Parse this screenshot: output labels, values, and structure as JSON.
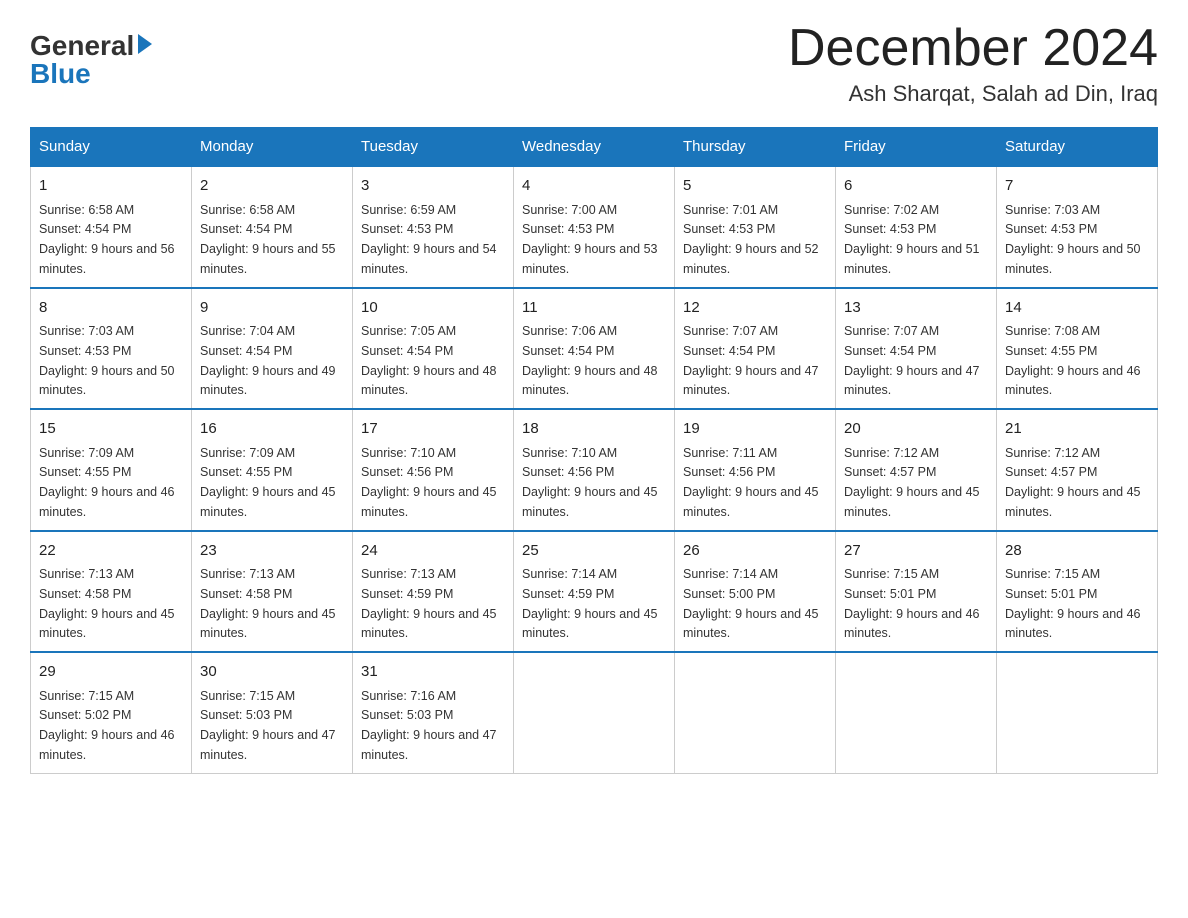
{
  "header": {
    "logo_general": "General",
    "logo_blue": "Blue",
    "month_title": "December 2024",
    "location": "Ash Sharqat, Salah ad Din, Iraq"
  },
  "weekdays": [
    "Sunday",
    "Monday",
    "Tuesday",
    "Wednesday",
    "Thursday",
    "Friday",
    "Saturday"
  ],
  "weeks": [
    [
      {
        "day": "1",
        "sunrise": "6:58 AM",
        "sunset": "4:54 PM",
        "daylight": "9 hours and 56 minutes."
      },
      {
        "day": "2",
        "sunrise": "6:58 AM",
        "sunset": "4:54 PM",
        "daylight": "9 hours and 55 minutes."
      },
      {
        "day": "3",
        "sunrise": "6:59 AM",
        "sunset": "4:53 PM",
        "daylight": "9 hours and 54 minutes."
      },
      {
        "day": "4",
        "sunrise": "7:00 AM",
        "sunset": "4:53 PM",
        "daylight": "9 hours and 53 minutes."
      },
      {
        "day": "5",
        "sunrise": "7:01 AM",
        "sunset": "4:53 PM",
        "daylight": "9 hours and 52 minutes."
      },
      {
        "day": "6",
        "sunrise": "7:02 AM",
        "sunset": "4:53 PM",
        "daylight": "9 hours and 51 minutes."
      },
      {
        "day": "7",
        "sunrise": "7:03 AM",
        "sunset": "4:53 PM",
        "daylight": "9 hours and 50 minutes."
      }
    ],
    [
      {
        "day": "8",
        "sunrise": "7:03 AM",
        "sunset": "4:53 PM",
        "daylight": "9 hours and 50 minutes."
      },
      {
        "day": "9",
        "sunrise": "7:04 AM",
        "sunset": "4:54 PM",
        "daylight": "9 hours and 49 minutes."
      },
      {
        "day": "10",
        "sunrise": "7:05 AM",
        "sunset": "4:54 PM",
        "daylight": "9 hours and 48 minutes."
      },
      {
        "day": "11",
        "sunrise": "7:06 AM",
        "sunset": "4:54 PM",
        "daylight": "9 hours and 48 minutes."
      },
      {
        "day": "12",
        "sunrise": "7:07 AM",
        "sunset": "4:54 PM",
        "daylight": "9 hours and 47 minutes."
      },
      {
        "day": "13",
        "sunrise": "7:07 AM",
        "sunset": "4:54 PM",
        "daylight": "9 hours and 47 minutes."
      },
      {
        "day": "14",
        "sunrise": "7:08 AM",
        "sunset": "4:55 PM",
        "daylight": "9 hours and 46 minutes."
      }
    ],
    [
      {
        "day": "15",
        "sunrise": "7:09 AM",
        "sunset": "4:55 PM",
        "daylight": "9 hours and 46 minutes."
      },
      {
        "day": "16",
        "sunrise": "7:09 AM",
        "sunset": "4:55 PM",
        "daylight": "9 hours and 45 minutes."
      },
      {
        "day": "17",
        "sunrise": "7:10 AM",
        "sunset": "4:56 PM",
        "daylight": "9 hours and 45 minutes."
      },
      {
        "day": "18",
        "sunrise": "7:10 AM",
        "sunset": "4:56 PM",
        "daylight": "9 hours and 45 minutes."
      },
      {
        "day": "19",
        "sunrise": "7:11 AM",
        "sunset": "4:56 PM",
        "daylight": "9 hours and 45 minutes."
      },
      {
        "day": "20",
        "sunrise": "7:12 AM",
        "sunset": "4:57 PM",
        "daylight": "9 hours and 45 minutes."
      },
      {
        "day": "21",
        "sunrise": "7:12 AM",
        "sunset": "4:57 PM",
        "daylight": "9 hours and 45 minutes."
      }
    ],
    [
      {
        "day": "22",
        "sunrise": "7:13 AM",
        "sunset": "4:58 PM",
        "daylight": "9 hours and 45 minutes."
      },
      {
        "day": "23",
        "sunrise": "7:13 AM",
        "sunset": "4:58 PM",
        "daylight": "9 hours and 45 minutes."
      },
      {
        "day": "24",
        "sunrise": "7:13 AM",
        "sunset": "4:59 PM",
        "daylight": "9 hours and 45 minutes."
      },
      {
        "day": "25",
        "sunrise": "7:14 AM",
        "sunset": "4:59 PM",
        "daylight": "9 hours and 45 minutes."
      },
      {
        "day": "26",
        "sunrise": "7:14 AM",
        "sunset": "5:00 PM",
        "daylight": "9 hours and 45 minutes."
      },
      {
        "day": "27",
        "sunrise": "7:15 AM",
        "sunset": "5:01 PM",
        "daylight": "9 hours and 46 minutes."
      },
      {
        "day": "28",
        "sunrise": "7:15 AM",
        "sunset": "5:01 PM",
        "daylight": "9 hours and 46 minutes."
      }
    ],
    [
      {
        "day": "29",
        "sunrise": "7:15 AM",
        "sunset": "5:02 PM",
        "daylight": "9 hours and 46 minutes."
      },
      {
        "day": "30",
        "sunrise": "7:15 AM",
        "sunset": "5:03 PM",
        "daylight": "9 hours and 47 minutes."
      },
      {
        "day": "31",
        "sunrise": "7:16 AM",
        "sunset": "5:03 PM",
        "daylight": "9 hours and 47 minutes."
      },
      null,
      null,
      null,
      null
    ]
  ]
}
